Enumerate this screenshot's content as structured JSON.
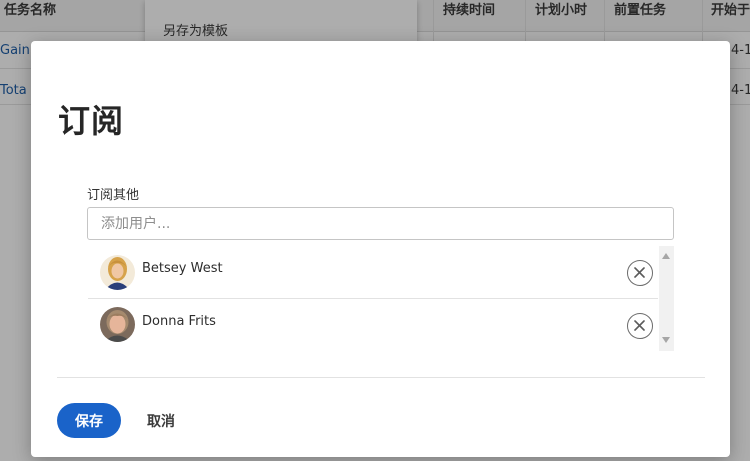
{
  "background": {
    "columns": [
      "任务名称",
      "持续时间",
      "计划小时",
      "前置任务",
      "开始于"
    ],
    "menu_item": "另存为模板",
    "rows": [
      "Gain",
      "Tota"
    ],
    "row_dates": [
      "4-1",
      "4-1"
    ]
  },
  "dialog": {
    "title": "订阅",
    "field_label": "订阅其他",
    "input_placeholder": "添加用户...",
    "subscribers": [
      {
        "name": "Betsey West"
      },
      {
        "name": "Donna Frits"
      }
    ],
    "save_label": "保存",
    "cancel_label": "取消"
  },
  "colors": {
    "primary": "#1a63c9",
    "overlay": "rgba(0,0,0,0.32)",
    "link": "#1f5fa8"
  }
}
